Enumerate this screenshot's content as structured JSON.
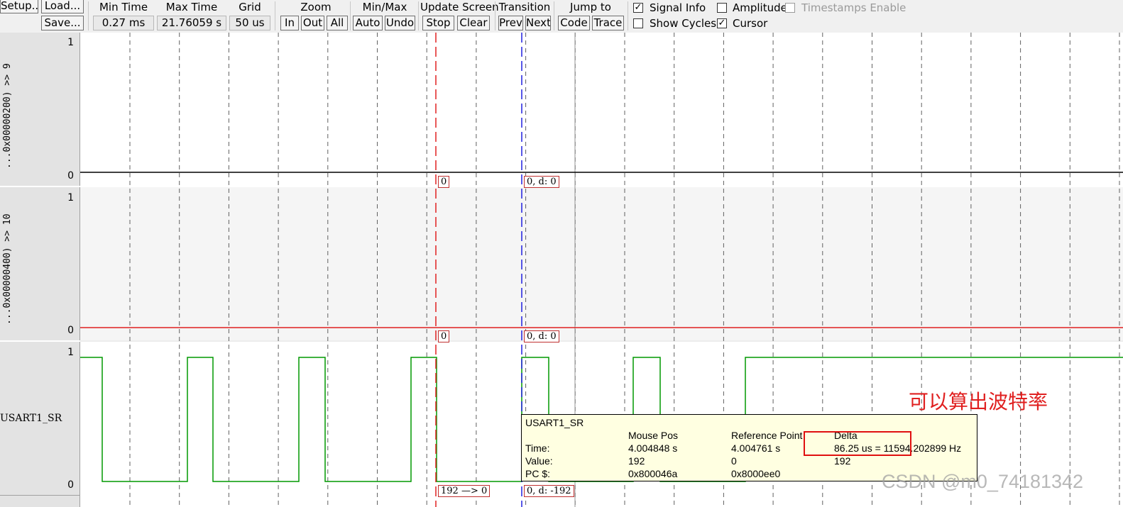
{
  "toolbar": {
    "setup": "Setup...",
    "load": "Load...",
    "save": "Save...",
    "min_time": {
      "label": "Min Time",
      "value": "0.27 ms"
    },
    "max_time": {
      "label": "Max Time",
      "value": "21.76059 s"
    },
    "grid": {
      "label": "Grid",
      "value": "50 us"
    },
    "zoom": {
      "label": "Zoom",
      "in": "In",
      "out": "Out",
      "all": "All"
    },
    "minmax": {
      "label": "Min/Max",
      "auto": "Auto",
      "undo": "Undo"
    },
    "update_screen": {
      "label": "Update Screen",
      "stop": "Stop",
      "clear": "Clear"
    },
    "transition": {
      "label": "Transition",
      "prev": "Prev",
      "next": "Next"
    },
    "jump_to": {
      "label": "Jump to",
      "code": "Code",
      "trace": "Trace"
    },
    "options": {
      "signal_info": {
        "label": "Signal Info",
        "checked": true
      },
      "amplitude": {
        "label": "Amplitude",
        "checked": false
      },
      "timestamps_enable": {
        "label": "Timestamps Enable",
        "checked": false,
        "disabled": true
      },
      "show_cycles": {
        "label": "Show Cycles",
        "checked": false
      },
      "cursor": {
        "label": "Cursor",
        "checked": true
      }
    }
  },
  "signals": [
    {
      "name": "...0x00000200) >> 9",
      "y_max": "1",
      "y_min": "0",
      "cursor_value": "0",
      "ref_value": "0,   d: 0",
      "trace_color": "#000000"
    },
    {
      "name": "...0x00000400) >> 10",
      "y_max": "1",
      "y_min": "0",
      "cursor_value": "0",
      "ref_value": "0,   d: 0",
      "trace_color": "#e02020"
    },
    {
      "name": "USART1_SR",
      "y_max": "1",
      "y_min": "0",
      "cursor_value": "192 —> 0",
      "ref_value": "0,   d: -192",
      "trace_color": "#009900"
    }
  ],
  "colors": {
    "cursor": "#e02020",
    "reference": "#2020e0",
    "grid": "#606060",
    "tooltip_bg": "#ffffe1"
  },
  "tooltip": {
    "signal": "USART1_SR",
    "headers": {
      "mouse_pos": "Mouse Pos",
      "reference_point": "Reference Point",
      "delta": "Delta"
    },
    "rows": [
      {
        "label": "Time:",
        "mouse": "4.004848 s",
        "ref": "4.004761 s",
        "delta": "86.25 us = 11594.202899 Hz"
      },
      {
        "label": "Value:",
        "mouse": "192",
        "ref": "0",
        "delta": "192"
      },
      {
        "label": "PC $:",
        "mouse": "0x800046a",
        "ref": "0x8000ee0",
        "delta": ""
      }
    ]
  },
  "annotation": "可以算出波特率",
  "watermark": "CSDN @m0_74181342"
}
